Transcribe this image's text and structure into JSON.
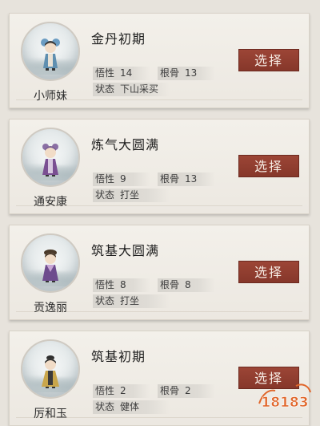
{
  "disciples": [
    {
      "name": "小师妹",
      "realm": "金丹初期",
      "wuxing_label": "悟性",
      "wuxing": "14",
      "gengu_label": "根骨",
      "gengu": "13",
      "state_label": "状态",
      "state": "下山采买",
      "robe": "#5f8fb0",
      "select_label": "选择",
      "avatar": "little-sister-figure"
    },
    {
      "name": "通安康",
      "realm": "炼气大圆满",
      "wuxing_label": "悟性",
      "wuxing": "9",
      "gengu_label": "根骨",
      "gengu": "13",
      "state_label": "状态",
      "state": "打坐",
      "robe": "#7a4f92",
      "select_label": "选择",
      "avatar": "tong-ankang-figure"
    },
    {
      "name": "贡逸丽",
      "realm": "筑基大圆满",
      "wuxing_label": "悟性",
      "wuxing": "8",
      "gengu_label": "根骨",
      "gengu": "8",
      "state_label": "状态",
      "state": "打坐",
      "robe": "#6d4b8d",
      "select_label": "选择",
      "avatar": "gong-yili-figure"
    },
    {
      "name": "厉和玉",
      "realm": "筑基初期",
      "wuxing_label": "悟性",
      "wuxing": "2",
      "gengu_label": "根骨",
      "gengu": "2",
      "state_label": "状态",
      "state": "健体",
      "robe": "#c9a64a",
      "select_label": "选择",
      "avatar": "li-heyu-figure"
    }
  ],
  "watermark": {
    "text": "18183",
    "color": "#e0662a"
  }
}
